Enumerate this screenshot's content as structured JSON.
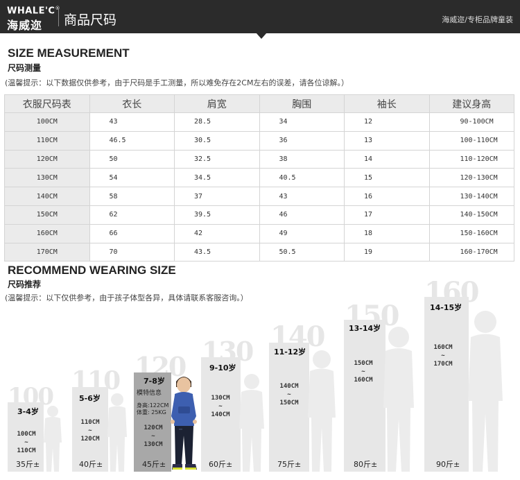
{
  "header": {
    "brand_en": "WHALE'C",
    "brand_reg": "®",
    "brand_cn": "海威迩",
    "title": "商品尺码",
    "right_text": "海威迩/专柜品牌童装"
  },
  "size_section": {
    "title_en": "SIZE MEASUREMENT",
    "title_cn": "尺码测量",
    "note": "(温馨提示：以下数据仅供参考，由于尺码是手工测量，所以难免存在2CM左右的误差，请各位谅解。）",
    "columns": [
      "衣服尺码表",
      "衣长",
      "肩宽",
      "胸围",
      "袖长",
      "建议身高"
    ],
    "rows": [
      [
        "100CM",
        "43",
        "28.5",
        "34",
        "12",
        "90-100CM"
      ],
      [
        "110CM",
        "46.5",
        "30.5",
        "36",
        "13",
        "100-110CM"
      ],
      [
        "120CM",
        "50",
        "32.5",
        "38",
        "14",
        "110-120CM"
      ],
      [
        "130CM",
        "54",
        "34.5",
        "40.5",
        "15",
        "120-130CM"
      ],
      [
        "140CM",
        "58",
        "37",
        "43",
        "16",
        "130-140CM"
      ],
      [
        "150CM",
        "62",
        "39.5",
        "46",
        "17",
        "140-150CM"
      ],
      [
        "160CM",
        "66",
        "42",
        "49",
        "18",
        "150-160CM"
      ],
      [
        "170CM",
        "70",
        "43.5",
        "50.5",
        "19",
        "160-170CM"
      ]
    ]
  },
  "wear_section": {
    "title_en": "RECOMMEND WEARING SIZE",
    "title_cn": "尺码推荐",
    "note": "(温馨提示：以下仅供参考，由于孩子体型各异，具体请联系客服咨询。）",
    "model_label": "模特信息",
    "model_height": "身高:122CM",
    "model_weight": "体重: 25KG",
    "tilde": "~",
    "sizes": [
      {
        "size": "100",
        "age": "3-4岁",
        "from": "100CM",
        "to": "110CM",
        "weight": "35斤±"
      },
      {
        "size": "110",
        "age": "5-6岁",
        "from": "110CM",
        "to": "120CM",
        "weight": "40斤±"
      },
      {
        "size": "120",
        "age": "7-8岁",
        "from": "120CM",
        "to": "130CM",
        "weight": "45斤±"
      },
      {
        "size": "130",
        "age": "9-10岁",
        "from": "130CM",
        "to": "140CM",
        "weight": "60斤±"
      },
      {
        "size": "140",
        "age": "11-12岁",
        "from": "140CM",
        "to": "150CM",
        "weight": "75斤±"
      },
      {
        "size": "150",
        "age": "13-14岁",
        "from": "150CM",
        "to": "160CM",
        "weight": "80斤±"
      },
      {
        "size": "160",
        "age": "14-15岁",
        "from": "160CM",
        "to": "170CM",
        "weight": "90斤±"
      }
    ]
  }
}
